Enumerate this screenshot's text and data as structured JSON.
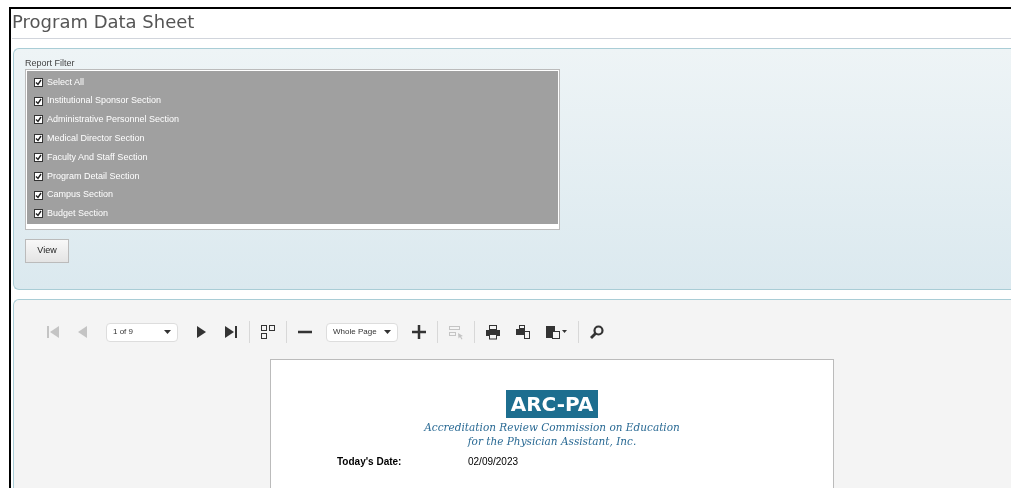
{
  "page_title": "Program Data Sheet",
  "report_filter": {
    "label": "Report Filter",
    "items": [
      {
        "label": "Select All",
        "checked": true
      },
      {
        "label": "Institutional Sponsor Section",
        "checked": true
      },
      {
        "label": "Administrative Personnel Section",
        "checked": true
      },
      {
        "label": "Medical Director Section",
        "checked": true
      },
      {
        "label": "Faculty And Staff Section",
        "checked": true
      },
      {
        "label": "Program Detail Section",
        "checked": true
      },
      {
        "label": "Campus Section",
        "checked": true
      },
      {
        "label": "Budget Section",
        "checked": true
      }
    ],
    "view_button": "View"
  },
  "toolbar": [
    {
      "kind": "first",
      "disabled": true
    },
    {
      "kind": "prev",
      "disabled": true
    },
    {
      "kind": "page_select",
      "value": "1 of 9"
    },
    {
      "kind": "next",
      "disabled": false
    },
    {
      "kind": "last",
      "disabled": false
    },
    {
      "kind": "sep"
    },
    {
      "kind": "multipage",
      "disabled": false
    },
    {
      "kind": "sep"
    },
    {
      "kind": "zoom_out",
      "disabled": false
    },
    {
      "kind": "zoom_select",
      "value": "Whole Page"
    },
    {
      "kind": "zoom_in",
      "disabled": false
    },
    {
      "kind": "sep"
    },
    {
      "kind": "select_tool",
      "disabled": true
    },
    {
      "kind": "sep"
    },
    {
      "kind": "print",
      "disabled": false
    },
    {
      "kind": "print_page",
      "disabled": false
    },
    {
      "kind": "export",
      "disabled": false
    },
    {
      "kind": "sep"
    },
    {
      "kind": "search",
      "disabled": false
    }
  ],
  "document": {
    "logo": "ARC-PA",
    "org_line_1": "Accreditation Review Commission on Education",
    "org_line_2": "for the Physician Assistant, Inc.",
    "fields": [
      {
        "label": "Today's Date:",
        "value": "02/09/2023"
      }
    ]
  }
}
